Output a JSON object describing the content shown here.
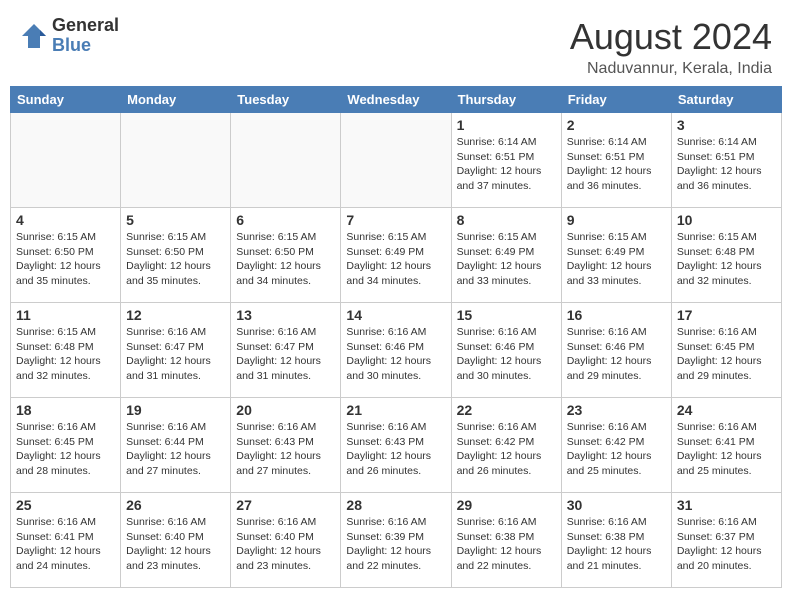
{
  "header": {
    "logo_general": "General",
    "logo_blue": "Blue",
    "month_title": "August 2024",
    "location": "Naduvannur, Kerala, India"
  },
  "calendar": {
    "days_of_week": [
      "Sunday",
      "Monday",
      "Tuesday",
      "Wednesday",
      "Thursday",
      "Friday",
      "Saturday"
    ],
    "weeks": [
      [
        {
          "day": "",
          "info": ""
        },
        {
          "day": "",
          "info": ""
        },
        {
          "day": "",
          "info": ""
        },
        {
          "day": "",
          "info": ""
        },
        {
          "day": "1",
          "info": "Sunrise: 6:14 AM\nSunset: 6:51 PM\nDaylight: 12 hours\nand 37 minutes."
        },
        {
          "day": "2",
          "info": "Sunrise: 6:14 AM\nSunset: 6:51 PM\nDaylight: 12 hours\nand 36 minutes."
        },
        {
          "day": "3",
          "info": "Sunrise: 6:14 AM\nSunset: 6:51 PM\nDaylight: 12 hours\nand 36 minutes."
        }
      ],
      [
        {
          "day": "4",
          "info": "Sunrise: 6:15 AM\nSunset: 6:50 PM\nDaylight: 12 hours\nand 35 minutes."
        },
        {
          "day": "5",
          "info": "Sunrise: 6:15 AM\nSunset: 6:50 PM\nDaylight: 12 hours\nand 35 minutes."
        },
        {
          "day": "6",
          "info": "Sunrise: 6:15 AM\nSunset: 6:50 PM\nDaylight: 12 hours\nand 34 minutes."
        },
        {
          "day": "7",
          "info": "Sunrise: 6:15 AM\nSunset: 6:49 PM\nDaylight: 12 hours\nand 34 minutes."
        },
        {
          "day": "8",
          "info": "Sunrise: 6:15 AM\nSunset: 6:49 PM\nDaylight: 12 hours\nand 33 minutes."
        },
        {
          "day": "9",
          "info": "Sunrise: 6:15 AM\nSunset: 6:49 PM\nDaylight: 12 hours\nand 33 minutes."
        },
        {
          "day": "10",
          "info": "Sunrise: 6:15 AM\nSunset: 6:48 PM\nDaylight: 12 hours\nand 32 minutes."
        }
      ],
      [
        {
          "day": "11",
          "info": "Sunrise: 6:15 AM\nSunset: 6:48 PM\nDaylight: 12 hours\nand 32 minutes."
        },
        {
          "day": "12",
          "info": "Sunrise: 6:16 AM\nSunset: 6:47 PM\nDaylight: 12 hours\nand 31 minutes."
        },
        {
          "day": "13",
          "info": "Sunrise: 6:16 AM\nSunset: 6:47 PM\nDaylight: 12 hours\nand 31 minutes."
        },
        {
          "day": "14",
          "info": "Sunrise: 6:16 AM\nSunset: 6:46 PM\nDaylight: 12 hours\nand 30 minutes."
        },
        {
          "day": "15",
          "info": "Sunrise: 6:16 AM\nSunset: 6:46 PM\nDaylight: 12 hours\nand 30 minutes."
        },
        {
          "day": "16",
          "info": "Sunrise: 6:16 AM\nSunset: 6:46 PM\nDaylight: 12 hours\nand 29 minutes."
        },
        {
          "day": "17",
          "info": "Sunrise: 6:16 AM\nSunset: 6:45 PM\nDaylight: 12 hours\nand 29 minutes."
        }
      ],
      [
        {
          "day": "18",
          "info": "Sunrise: 6:16 AM\nSunset: 6:45 PM\nDaylight: 12 hours\nand 28 minutes."
        },
        {
          "day": "19",
          "info": "Sunrise: 6:16 AM\nSunset: 6:44 PM\nDaylight: 12 hours\nand 27 minutes."
        },
        {
          "day": "20",
          "info": "Sunrise: 6:16 AM\nSunset: 6:43 PM\nDaylight: 12 hours\nand 27 minutes."
        },
        {
          "day": "21",
          "info": "Sunrise: 6:16 AM\nSunset: 6:43 PM\nDaylight: 12 hours\nand 26 minutes."
        },
        {
          "day": "22",
          "info": "Sunrise: 6:16 AM\nSunset: 6:42 PM\nDaylight: 12 hours\nand 26 minutes."
        },
        {
          "day": "23",
          "info": "Sunrise: 6:16 AM\nSunset: 6:42 PM\nDaylight: 12 hours\nand 25 minutes."
        },
        {
          "day": "24",
          "info": "Sunrise: 6:16 AM\nSunset: 6:41 PM\nDaylight: 12 hours\nand 25 minutes."
        }
      ],
      [
        {
          "day": "25",
          "info": "Sunrise: 6:16 AM\nSunset: 6:41 PM\nDaylight: 12 hours\nand 24 minutes."
        },
        {
          "day": "26",
          "info": "Sunrise: 6:16 AM\nSunset: 6:40 PM\nDaylight: 12 hours\nand 23 minutes."
        },
        {
          "day": "27",
          "info": "Sunrise: 6:16 AM\nSunset: 6:40 PM\nDaylight: 12 hours\nand 23 minutes."
        },
        {
          "day": "28",
          "info": "Sunrise: 6:16 AM\nSunset: 6:39 PM\nDaylight: 12 hours\nand 22 minutes."
        },
        {
          "day": "29",
          "info": "Sunrise: 6:16 AM\nSunset: 6:38 PM\nDaylight: 12 hours\nand 22 minutes."
        },
        {
          "day": "30",
          "info": "Sunrise: 6:16 AM\nSunset: 6:38 PM\nDaylight: 12 hours\nand 21 minutes."
        },
        {
          "day": "31",
          "info": "Sunrise: 6:16 AM\nSunset: 6:37 PM\nDaylight: 12 hours\nand 20 minutes."
        }
      ]
    ]
  }
}
